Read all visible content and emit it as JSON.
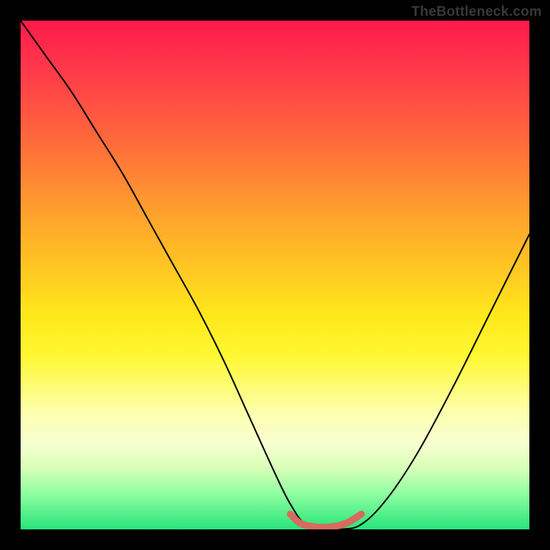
{
  "watermark": "TheBottleneck.com",
  "colors": {
    "frame": "#000000",
    "curve": "#000000",
    "highlight": "#d86a5e",
    "gradient_top": "#ff1a4b",
    "gradient_bottom": "#28e47a"
  },
  "chart_data": {
    "type": "line",
    "title": "",
    "xlabel": "",
    "ylabel": "",
    "xlim": [
      0,
      1
    ],
    "ylim": [
      0,
      1
    ],
    "note": "No axis ticks or numeric labels are rendered; values below are normalized estimates read from pixel positions (0,0 = bottom-left of gradient area).",
    "series": [
      {
        "name": "main-curve",
        "x": [
          0.0,
          0.05,
          0.1,
          0.15,
          0.2,
          0.25,
          0.3,
          0.35,
          0.4,
          0.45,
          0.5,
          0.53,
          0.56,
          0.6,
          0.63,
          0.67,
          0.72,
          0.78,
          0.85,
          0.92,
          1.0
        ],
        "y": [
          1.0,
          0.93,
          0.86,
          0.78,
          0.7,
          0.61,
          0.52,
          0.43,
          0.33,
          0.22,
          0.11,
          0.05,
          0.01,
          0.0,
          0.0,
          0.01,
          0.06,
          0.15,
          0.28,
          0.42,
          0.58
        ]
      },
      {
        "name": "bottom-highlight",
        "x": [
          0.53,
          0.55,
          0.58,
          0.61,
          0.64,
          0.67
        ],
        "y": [
          0.03,
          0.012,
          0.005,
          0.005,
          0.012,
          0.03
        ]
      }
    ]
  }
}
